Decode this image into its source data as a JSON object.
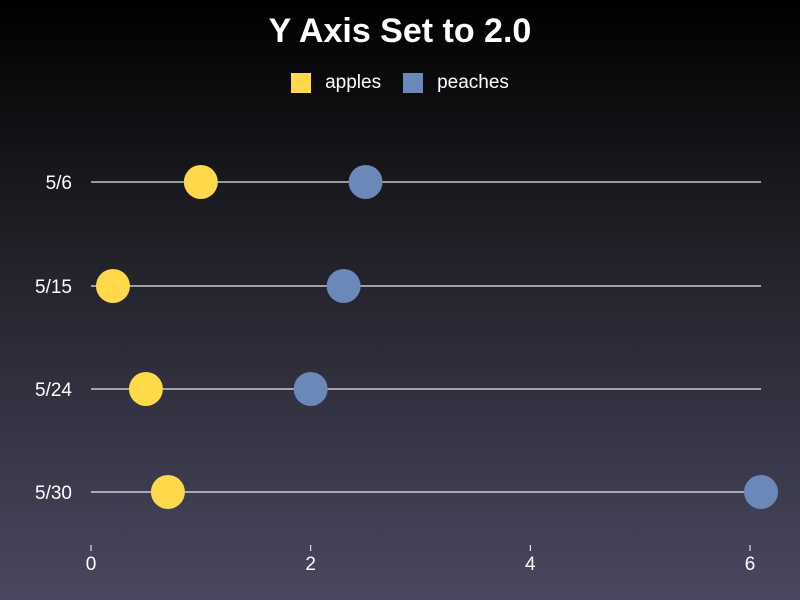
{
  "chart_data": {
    "type": "scatter",
    "title": "Y Axis Set to 2.0",
    "categories": [
      "5/6",
      "5/15",
      "5/24",
      "5/30"
    ],
    "series": [
      {
        "name": "apples",
        "color": "#ffd94a",
        "values": [
          1.0,
          0.2,
          0.5,
          0.7
        ]
      },
      {
        "name": "peaches",
        "color": "#6a88b8",
        "values": [
          2.5,
          2.3,
          2.0,
          6.1
        ]
      }
    ],
    "xlim": [
      0,
      6.1
    ],
    "xticks": [
      "0",
      "2",
      "4",
      "6"
    ],
    "legend": "top-center",
    "grid": false
  }
}
